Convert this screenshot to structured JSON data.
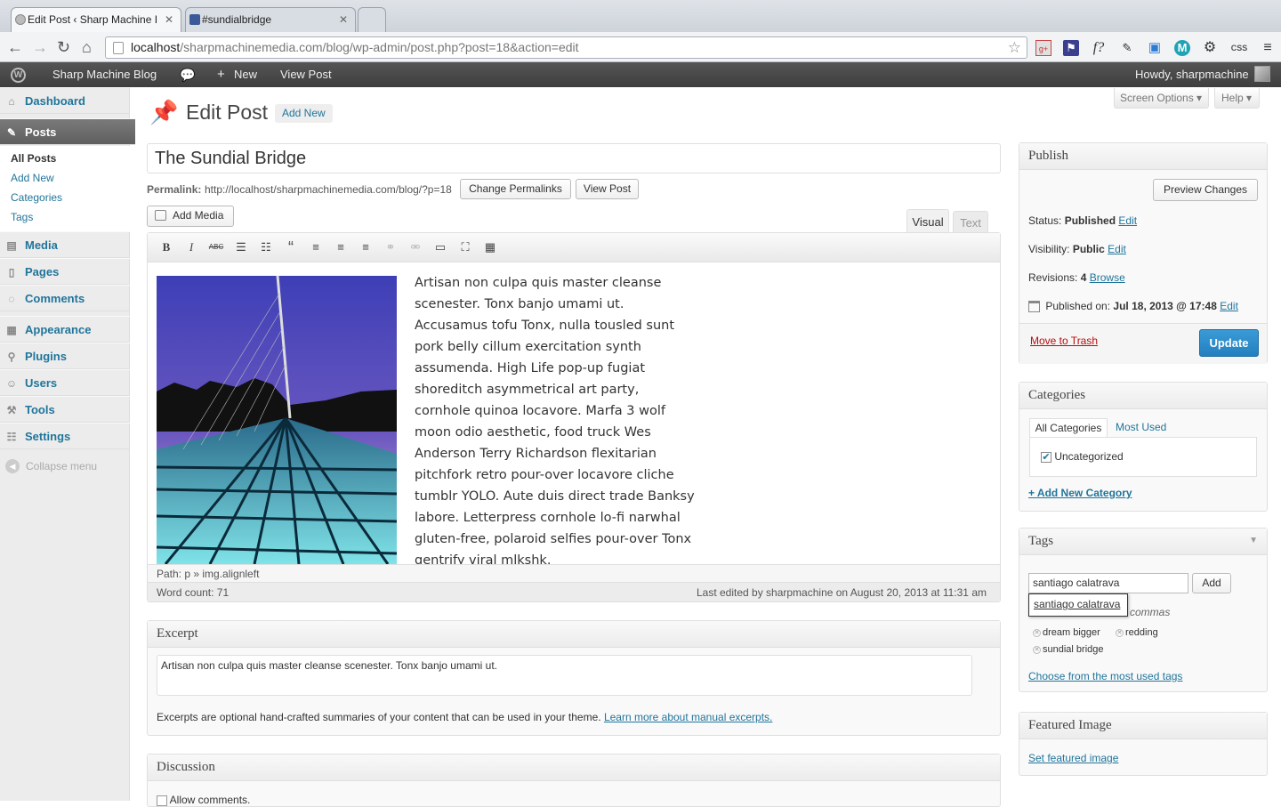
{
  "browser": {
    "tabs": [
      {
        "title": "Edit Post ‹ Sharp Machine I",
        "active": true
      },
      {
        "title": "#sundialbridge",
        "active": false
      }
    ],
    "url_host": "localhost",
    "url_path": "/sharpmachinemedia.com/blog/wp-admin/post.php?post=18&action=edit",
    "extensions": [
      "star-icon",
      "gplus-icon",
      "flag-icon",
      "f?",
      "eyedropper-icon",
      "frame-icon",
      "M",
      "gear-icon",
      "CSS",
      "menu-icon"
    ],
    "ext_f": "f?",
    "ext_m": "M",
    "ext_css": "CSS"
  },
  "adminbar": {
    "site_name": "Sharp Machine Blog",
    "new_label": "New",
    "view_post": "View Post",
    "howdy": "Howdy, sharpmachine"
  },
  "sidebar": {
    "dashboard": "Dashboard",
    "posts": "Posts",
    "posts_sub": [
      "All Posts",
      "Add New",
      "Categories",
      "Tags"
    ],
    "media": "Media",
    "pages": "Pages",
    "comments": "Comments",
    "appearance": "Appearance",
    "plugins": "Plugins",
    "users": "Users",
    "tools": "Tools",
    "settings": "Settings",
    "collapse": "Collapse menu"
  },
  "header": {
    "title": "Edit Post",
    "add_new": "Add New",
    "screen_options": "Screen Options",
    "help": "Help"
  },
  "post": {
    "title": "The Sundial Bridge",
    "permalink_label": "Permalink:",
    "permalink_url": "http://localhost/sharpmachinemedia.com/blog/?p=18",
    "change_permalinks": "Change Permalinks",
    "view_post": "View Post",
    "add_media": "Add Media",
    "tab_visual": "Visual",
    "tab_text": "Text",
    "body": "Artisan non culpa quis master cleanse scenester. Tonx banjo umami ut. Accusamus tofu Tonx, nulla tousled sunt pork belly cillum exercitation synth assumenda. High Life pop-up fugiat shoreditch asymmetrical art party, cornhole quinoa locavore. Marfa 3 wolf moon odio aesthetic, food truck Wes Anderson Terry Richardson flexitarian pitchfork retro pour-over locavore cliche tumblr YOLO. Aute duis direct trade Banksy labore. Letterpress cornhole lo-fi narwhal gluten-free, polaroid selfies pour-over Tonx gentrify viral mlkshk.",
    "path": "Path: p » img.alignleft",
    "word_count": "Word count: 71",
    "last_edited": "Last edited by sharpmachine on August 20, 2013 at 11:31 am"
  },
  "excerpt": {
    "title": "Excerpt",
    "value": "Artisan non culpa quis master cleanse scenester. Tonx banjo umami ut.",
    "help": "Excerpts are optional hand-crafted summaries of your content that can be used in your theme.",
    "learn_more": "Learn more about manual excerpts."
  },
  "discussion": {
    "title": "Discussion",
    "allow_comments": "Allow comments."
  },
  "publish": {
    "title": "Publish",
    "preview": "Preview Changes",
    "status_label": "Status:",
    "status_value": "Published",
    "visibility_label": "Visibility:",
    "visibility_value": "Public",
    "revisions_label": "Revisions:",
    "revisions_value": "4",
    "browse": "Browse",
    "published_on_label": "Published on:",
    "published_on_value": "Jul 18, 2013 @ 17:48",
    "edit": "Edit",
    "trash": "Move to Trash",
    "update": "Update"
  },
  "categories": {
    "title": "Categories",
    "tab_all": "All Categories",
    "tab_most": "Most Used",
    "items": [
      {
        "label": "Uncategorized",
        "checked": true
      }
    ],
    "add_new": "+ Add New Category"
  },
  "tags": {
    "title": "Tags",
    "input_value": "santiago calatrava",
    "add": "Add",
    "suggestion": "santiago calatrava",
    "hint": "commas",
    "list": [
      "dream bigger",
      "redding",
      "sundial bridge"
    ],
    "choose": "Choose from the most used tags"
  },
  "featured_image": {
    "title": "Featured Image",
    "set": "Set featured image"
  },
  "colors": {
    "link": "#21759b",
    "update_btn": "#2e8ec4",
    "trash": "#bc0b0b"
  }
}
